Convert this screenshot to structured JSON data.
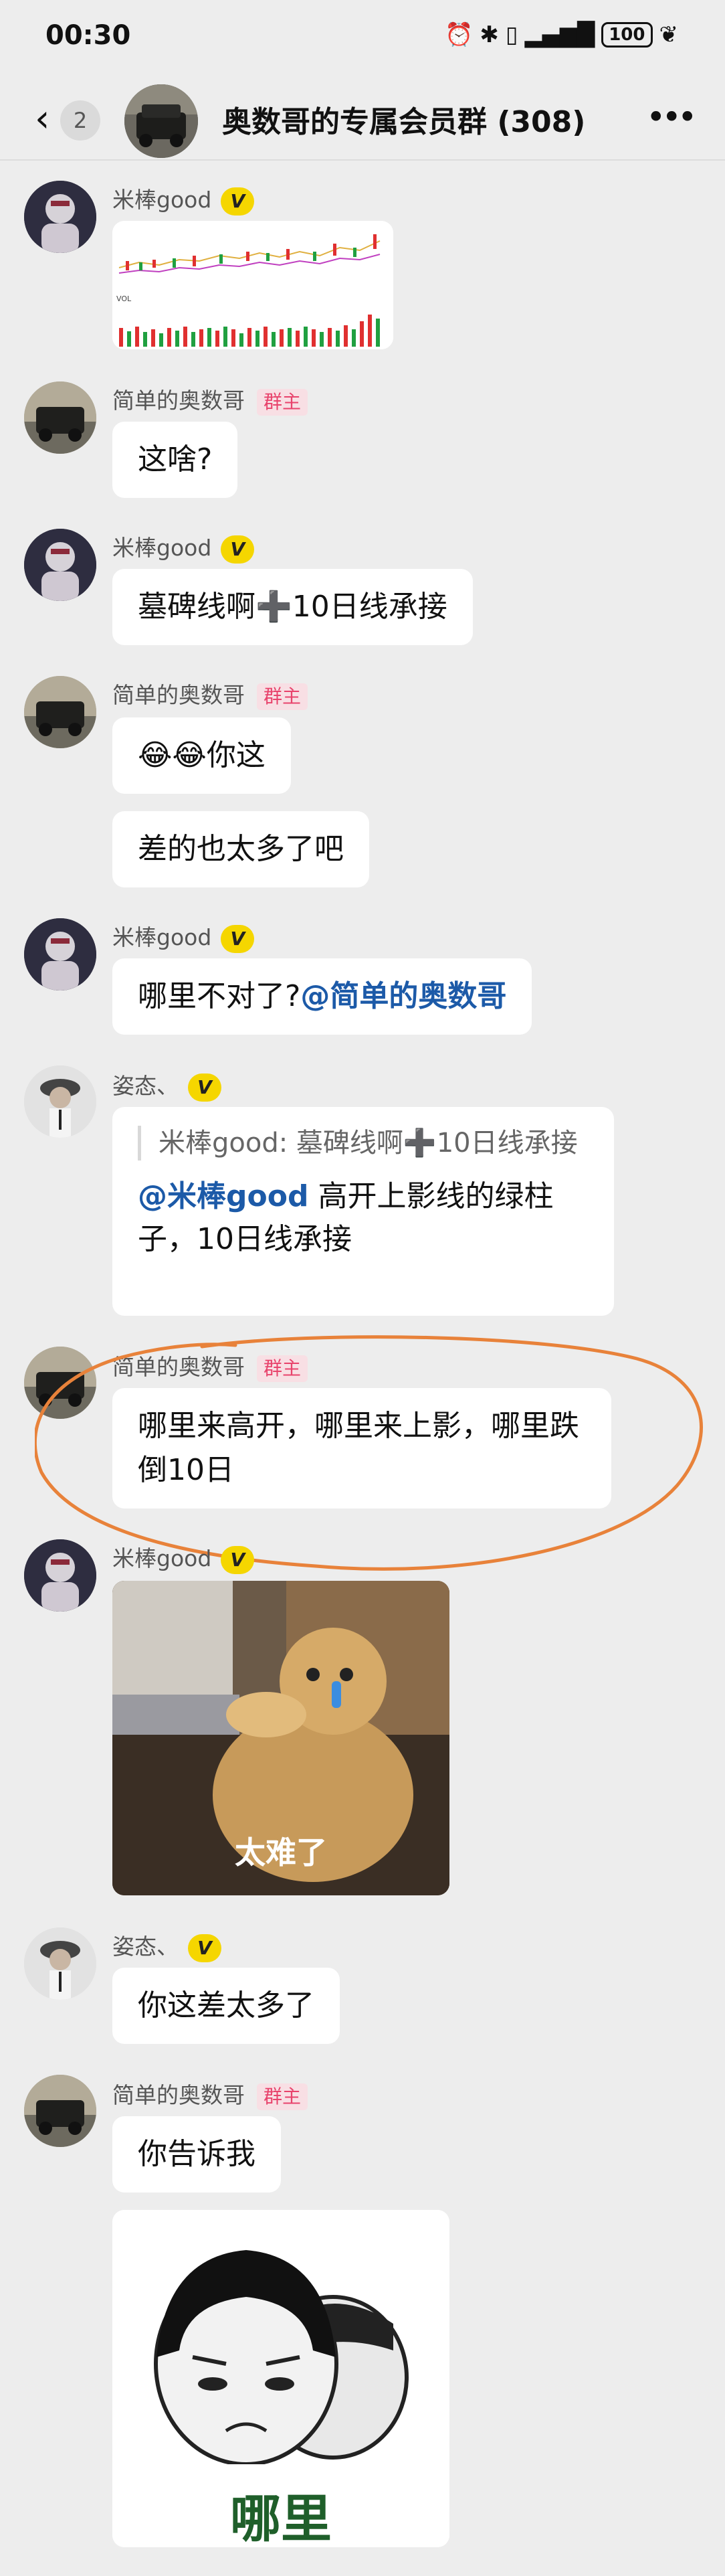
{
  "status_bar": {
    "time": "00:30",
    "battery": "100"
  },
  "header": {
    "unread_count": "2",
    "group_title": "奥数哥的专属会员群 (308)"
  },
  "badges": {
    "verified": "V",
    "owner": "群主"
  },
  "users": {
    "mi": "米棒good",
    "jian": "简单的奥数哥",
    "zi": "姿态、"
  },
  "messages": {
    "m2": "这啥?",
    "m3": "墓碑线啊➕10日线承接",
    "m4a_emoji": "😂😂",
    "m4a": "你这",
    "m4b": "差的也太多了吧",
    "m5_text": "哪里不对了?",
    "m5_mention": "@简单的奥数哥",
    "m6_quote": "米棒good: 墓碑线啊➕10日线承接",
    "m6_mention": "@米棒good",
    "m6_text": " 高开上影线的绿柱子，10日线承接",
    "m7": "哪里来高开，哪里来上影，哪里跌倒10日",
    "m8_caption": "太难了",
    "m9": "你这差太多了",
    "m10": "你告诉我",
    "m11_caption": "哪里"
  },
  "colors": {
    "accent_orange": "#e8823a",
    "mention_blue": "#1c5aa8"
  }
}
